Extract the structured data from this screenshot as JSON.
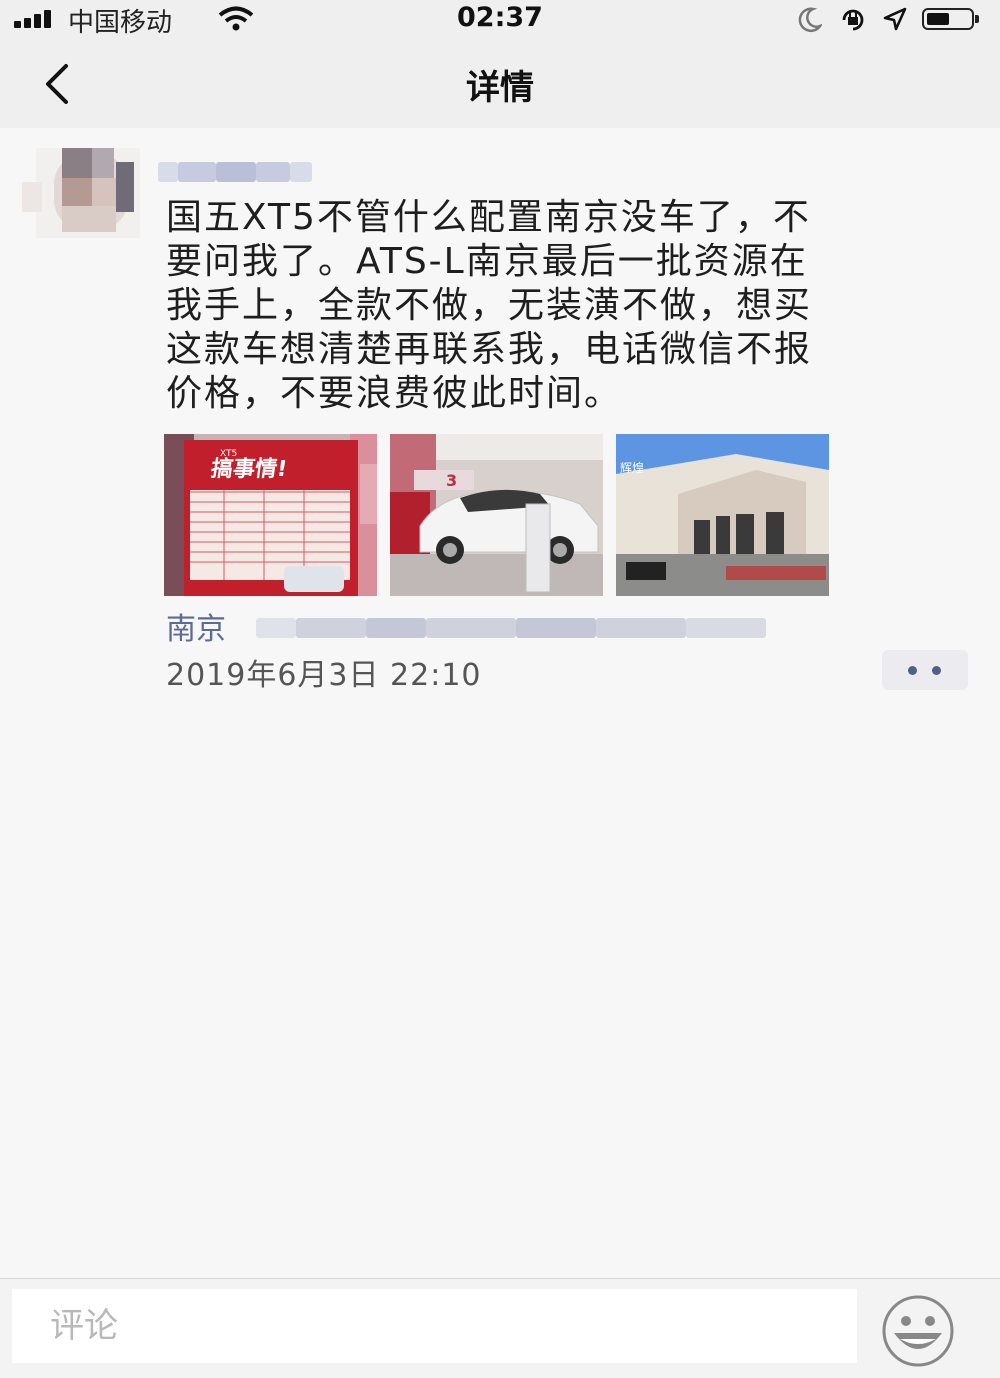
{
  "status_bar": {
    "carrier": "中国移动",
    "time": "02:37"
  },
  "nav": {
    "title": "详情"
  },
  "post": {
    "text_lines": [
      "国五XT5不管什么配置南京没车了，不",
      "要问我了。ATS-L南京最后一批资源在",
      "我手上，全款不做，无装潢不做，想买",
      "这款车想清楚再联系我，电话微信不报",
      "价格，不要浪费彼此时间。"
    ],
    "photos": [
      {
        "overlay_text_1": "XT5",
        "overlay_text_2": "搞事情!"
      },
      {
        "overlay_text_1": "3"
      },
      {
        "overlay_text_1": "辉煌"
      }
    ],
    "location": "南京",
    "timestamp": "2019年6月3日  22:10"
  },
  "bottom": {
    "comment_placeholder": "评论"
  },
  "colors": {
    "link_blue": "#5b6b93",
    "background": "#f7f7f7",
    "nav_background": "#efefef"
  }
}
